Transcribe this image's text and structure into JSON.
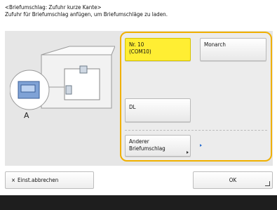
{
  "header": {
    "line1": "<Briefumschlag: Zufuhr kurze Kante>",
    "line2": "Zufuhr für Briefumschlag anfügen, um Briefumschläge zu laden."
  },
  "illustration": {
    "tray_label": "A"
  },
  "options": [
    {
      "label_line1": "Nr. 10",
      "label_line2": "(COM10)",
      "selected": true
    },
    {
      "label_line1": "Monarch",
      "label_line2": "",
      "selected": false
    },
    {
      "label_line1": "DL",
      "label_line2": "",
      "selected": false
    },
    {
      "label_line1": "Anderer",
      "label_line2": "Briefumschlag",
      "selected": false
    }
  ],
  "footer": {
    "cancel_icon": "×",
    "cancel_label": "Einst.abbrechen",
    "ok_label": "OK"
  },
  "colors": {
    "selected": "#ffee33",
    "focus_border": "#f0b000",
    "accent_arrow": "#2a6fd0"
  }
}
